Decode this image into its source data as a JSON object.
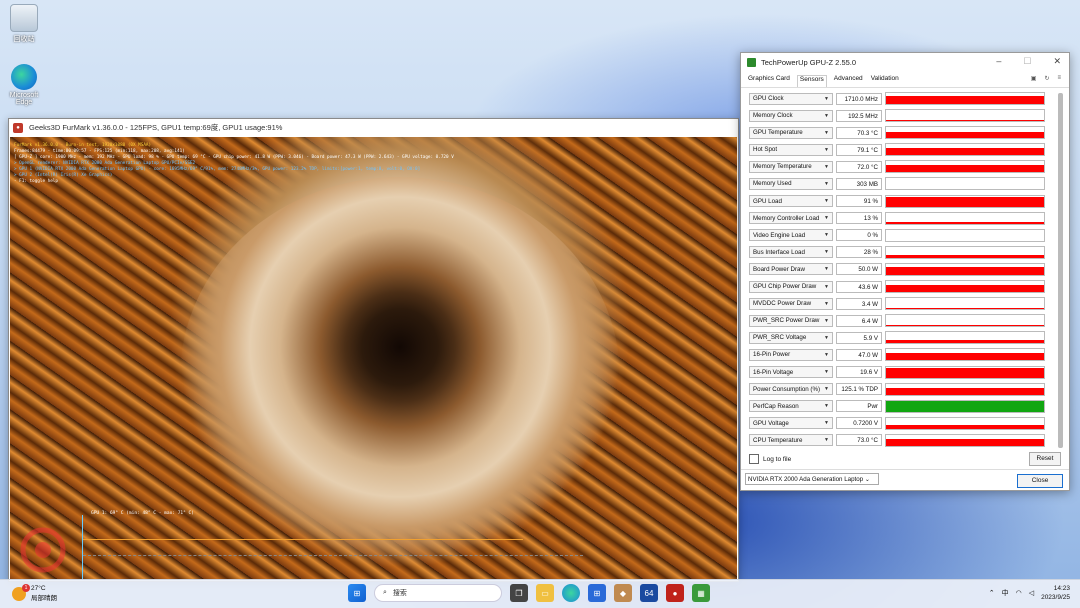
{
  "desktop": {
    "icons": [
      {
        "label": "回收站",
        "icon": "recycle-bin-icon"
      },
      {
        "label": "Microsoft Edge",
        "icon": "edge-icon"
      }
    ]
  },
  "furmark": {
    "title": "Geeks3D FurMark v1.36.0.0 - 125FPS, GPU1 temp:69度, GPU1 usage:91%",
    "overlay": [
      {
        "text": "FurMark v1.36.0.0 - Burn-in test, 1920x1080 (0X MSAA)",
        "color": "#ffd23a"
      },
      {
        "text": "Frames:84479 - time:00:09:57 - FPS:125 (min:118, max:208, avg:141)",
        "color": "#ffffff"
      },
      {
        "text": "[ GPU-Z ] core: 1900 MHz - mem: 192 MHz - GPU load: 98 % - GPU temp: 69 °C - GPU chip power: 41.8 W (PPW: 3.046) - Board power: 47.3 W (PPW: 2.643) - GPU voltage: 0.720 V",
        "color": "#ffffff"
      },
      {
        "text": "> OpenGL renderer: NVIDIA RTX 2000 Ada Generation Laptop GPU/PCIe/SSE2",
        "color": "#6fc3ff"
      },
      {
        "text": "> GPU 1 (NVIDIA RTX 2000 Ada Generation Laptop GPU) - core: 1695MHz/69° C/91%, mem: 2748MHz/3%, GPU power: 123.2% TDP, limits:[power:1, temp:0, volt:0, OV:0]",
        "color": "#6fc3ff"
      },
      {
        "text": "> GPU 2 (Intel(R) Iris(R) Xe Graphics)",
        "color": "#6fc3ff"
      },
      {
        "text": "- F1: toggle help",
        "color": "#ffffff"
      }
    ],
    "graph_label": "GPU 1: 69° C (min: 48° C - max: 71° C)"
  },
  "gpuz": {
    "title": "TechPowerUp GPU-Z 2.55.0",
    "tabs": [
      "Graphics Card",
      "Sensors",
      "Advanced",
      "Validation"
    ],
    "active_tab": "Sensors",
    "sensors": [
      {
        "name": "GPU Clock",
        "value": "1710.0 MHz",
        "fill": 0.75,
        "color": "#ff0000"
      },
      {
        "name": "Memory Clock",
        "value": "192.5 MHz",
        "fill": 0.08,
        "color": "#ff0000"
      },
      {
        "name": "GPU Temperature",
        "value": "70.3 °C",
        "fill": 0.6,
        "color": "#ff0000"
      },
      {
        "name": "Hot Spot",
        "value": "79.1 °C",
        "fill": 0.7,
        "color": "#ff0000"
      },
      {
        "name": "Memory Temperature",
        "value": "72.0 °C",
        "fill": 0.65,
        "color": "#ff0000"
      },
      {
        "name": "Memory Used",
        "value": "303 MB",
        "fill": 0.0,
        "color": "#ff0000"
      },
      {
        "name": "GPU Load",
        "value": "91 %",
        "fill": 0.85,
        "color": "#ff0000"
      },
      {
        "name": "Memory Controller Load",
        "value": "13 %",
        "fill": 0.13,
        "color": "#ff0000"
      },
      {
        "name": "Video Engine Load",
        "value": "0 %",
        "fill": 0.0,
        "color": "#ff0000"
      },
      {
        "name": "Bus Interface Load",
        "value": "28 %",
        "fill": 0.28,
        "color": "#ff0000"
      },
      {
        "name": "Board Power Draw",
        "value": "50.0 W",
        "fill": 0.7,
        "color": "#ff0000"
      },
      {
        "name": "GPU Chip Power Draw",
        "value": "43.6 W",
        "fill": 0.65,
        "color": "#ff0000"
      },
      {
        "name": "MVDDC Power Draw",
        "value": "3.4 W",
        "fill": 0.1,
        "color": "#ff0000"
      },
      {
        "name": "PWR_SRC Power Draw",
        "value": "6.4 W",
        "fill": 0.15,
        "color": "#ff0000"
      },
      {
        "name": "PWR_SRC Voltage",
        "value": "5.9 V",
        "fill": 0.3,
        "color": "#ff0000"
      },
      {
        "name": "16-Pin Power",
        "value": "47.0 W",
        "fill": 0.7,
        "color": "#ff0000"
      },
      {
        "name": "16-Pin Voltage",
        "value": "19.6 V",
        "fill": 0.85,
        "color": "#ff0000"
      },
      {
        "name": "Power Consumption (%)",
        "value": "125.1 % TDP",
        "fill": 0.6,
        "color": "#ff0000"
      },
      {
        "name": "PerfCap Reason",
        "value": "Pwr",
        "fill": 1.0,
        "color": "#11a611"
      },
      {
        "name": "GPU Voltage",
        "value": "0.7200 V",
        "fill": 0.35,
        "color": "#ff0000"
      },
      {
        "name": "CPU Temperature",
        "value": "73.0 °C",
        "fill": 0.6,
        "color": "#ff0000"
      }
    ],
    "log_label": "Log to file",
    "reset_label": "Reset",
    "gpu_select": "NVIDIA RTX 2000 Ada Generation Laptop",
    "close_label": "Close"
  },
  "taskbar": {
    "weather_temp": "27°C",
    "weather_desc": "局部晴朗",
    "weather_badge": "1",
    "search_placeholder": "搜索",
    "tray_lang": "中",
    "time": "14:23",
    "date": "2023/9/25"
  }
}
